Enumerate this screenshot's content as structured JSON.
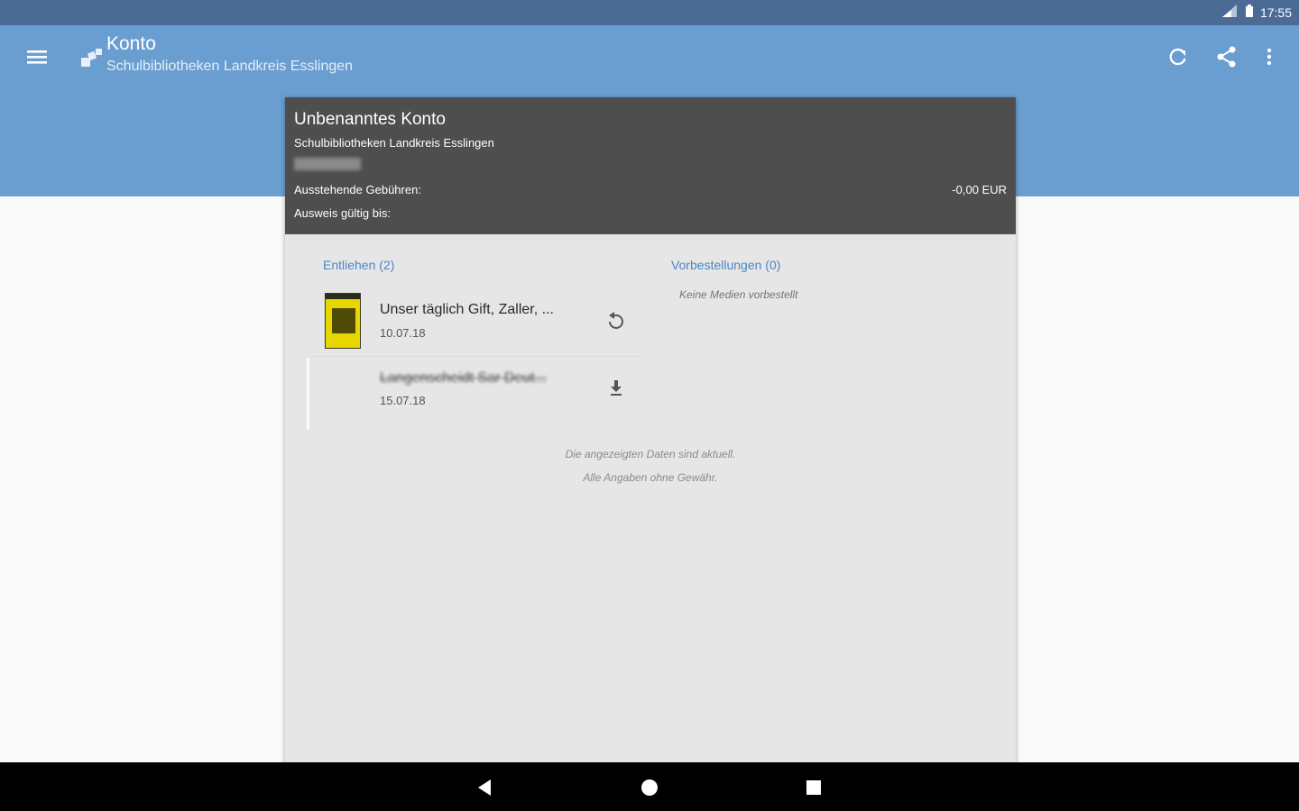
{
  "status_bar": {
    "time": "17:55"
  },
  "app_bar": {
    "title": "Konto",
    "subtitle": "Schulbibliotheken Landkreis Esslingen",
    "actions": [
      "refresh-icon",
      "share-icon",
      "more-vert-icon"
    ]
  },
  "account": {
    "name": "Unbenanntes Konto",
    "library": "Schulbibliotheken Landkreis Esslingen",
    "fees_label": "Ausstehende Gebühren:",
    "fees_value": "-0,00 EUR",
    "valid_label": "Ausweis gültig bis:"
  },
  "lent": {
    "header": "Entliehen (2)",
    "items": [
      {
        "title": "Unser täglich Gift, Zaller, ...",
        "date": "10.07.18",
        "action_icon": "renew-icon"
      },
      {
        "title": "Langenscheidt Sar Deut...",
        "date": "15.07.18",
        "action_icon": "download-icon"
      }
    ]
  },
  "reservations": {
    "header": "Vorbestellungen (0)",
    "empty_text": "Keine Medien vorbestellt"
  },
  "footer": {
    "line1": "Die angezeigten Daten sind aktuell.",
    "line2": "Alle Angaben ohne Gewähr."
  },
  "colors": {
    "status_bar": "#4a6b94",
    "app_bar": "#6a9ed0",
    "card_header": "#4e4e4e",
    "accent": "#4a86c5"
  }
}
